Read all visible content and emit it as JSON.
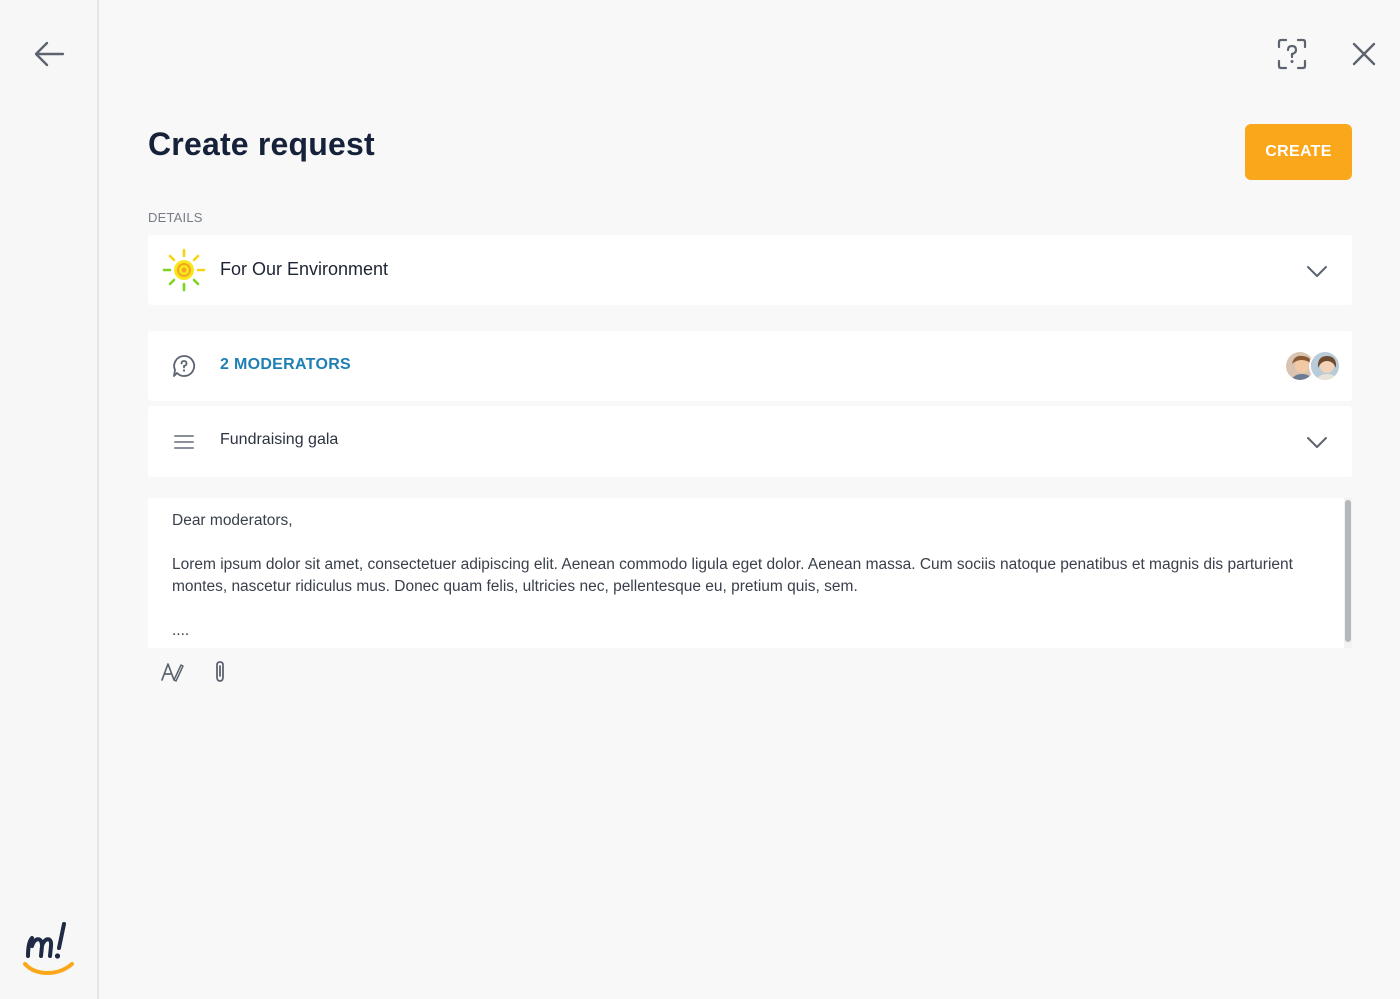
{
  "page": {
    "title": "Create request",
    "create_label": "CREATE",
    "details_label": "DETAILS"
  },
  "community": {
    "name": "For Our Environment",
    "icon": "sun-logo-icon"
  },
  "moderators": {
    "label": "2 MODERATORS",
    "icon": "question-bubble-icon",
    "avatar_count": 2
  },
  "topic": {
    "value": "Fundraising gala",
    "icon": "menu-lines-icon"
  },
  "message": {
    "greeting": "Dear moderators,",
    "body": "Lorem ipsum dolor sit amet, consectetuer adipiscing elit. Aenean commodo ligula eget dolor. Aenean massa. Cum sociis natoque penatibus et magnis dis parturient montes, nascetur ridiculus mus. Donec quam felis, ultricies nec, pellentesque eu, pretium quis, sem.",
    "ellipsis": "...."
  },
  "toolbar": {
    "format_icon": "text-format-icon",
    "attach_icon": "paperclip-icon"
  },
  "colors": {
    "accent": "#fba71b",
    "link": "#1f7fb5",
    "title": "#16213a"
  }
}
